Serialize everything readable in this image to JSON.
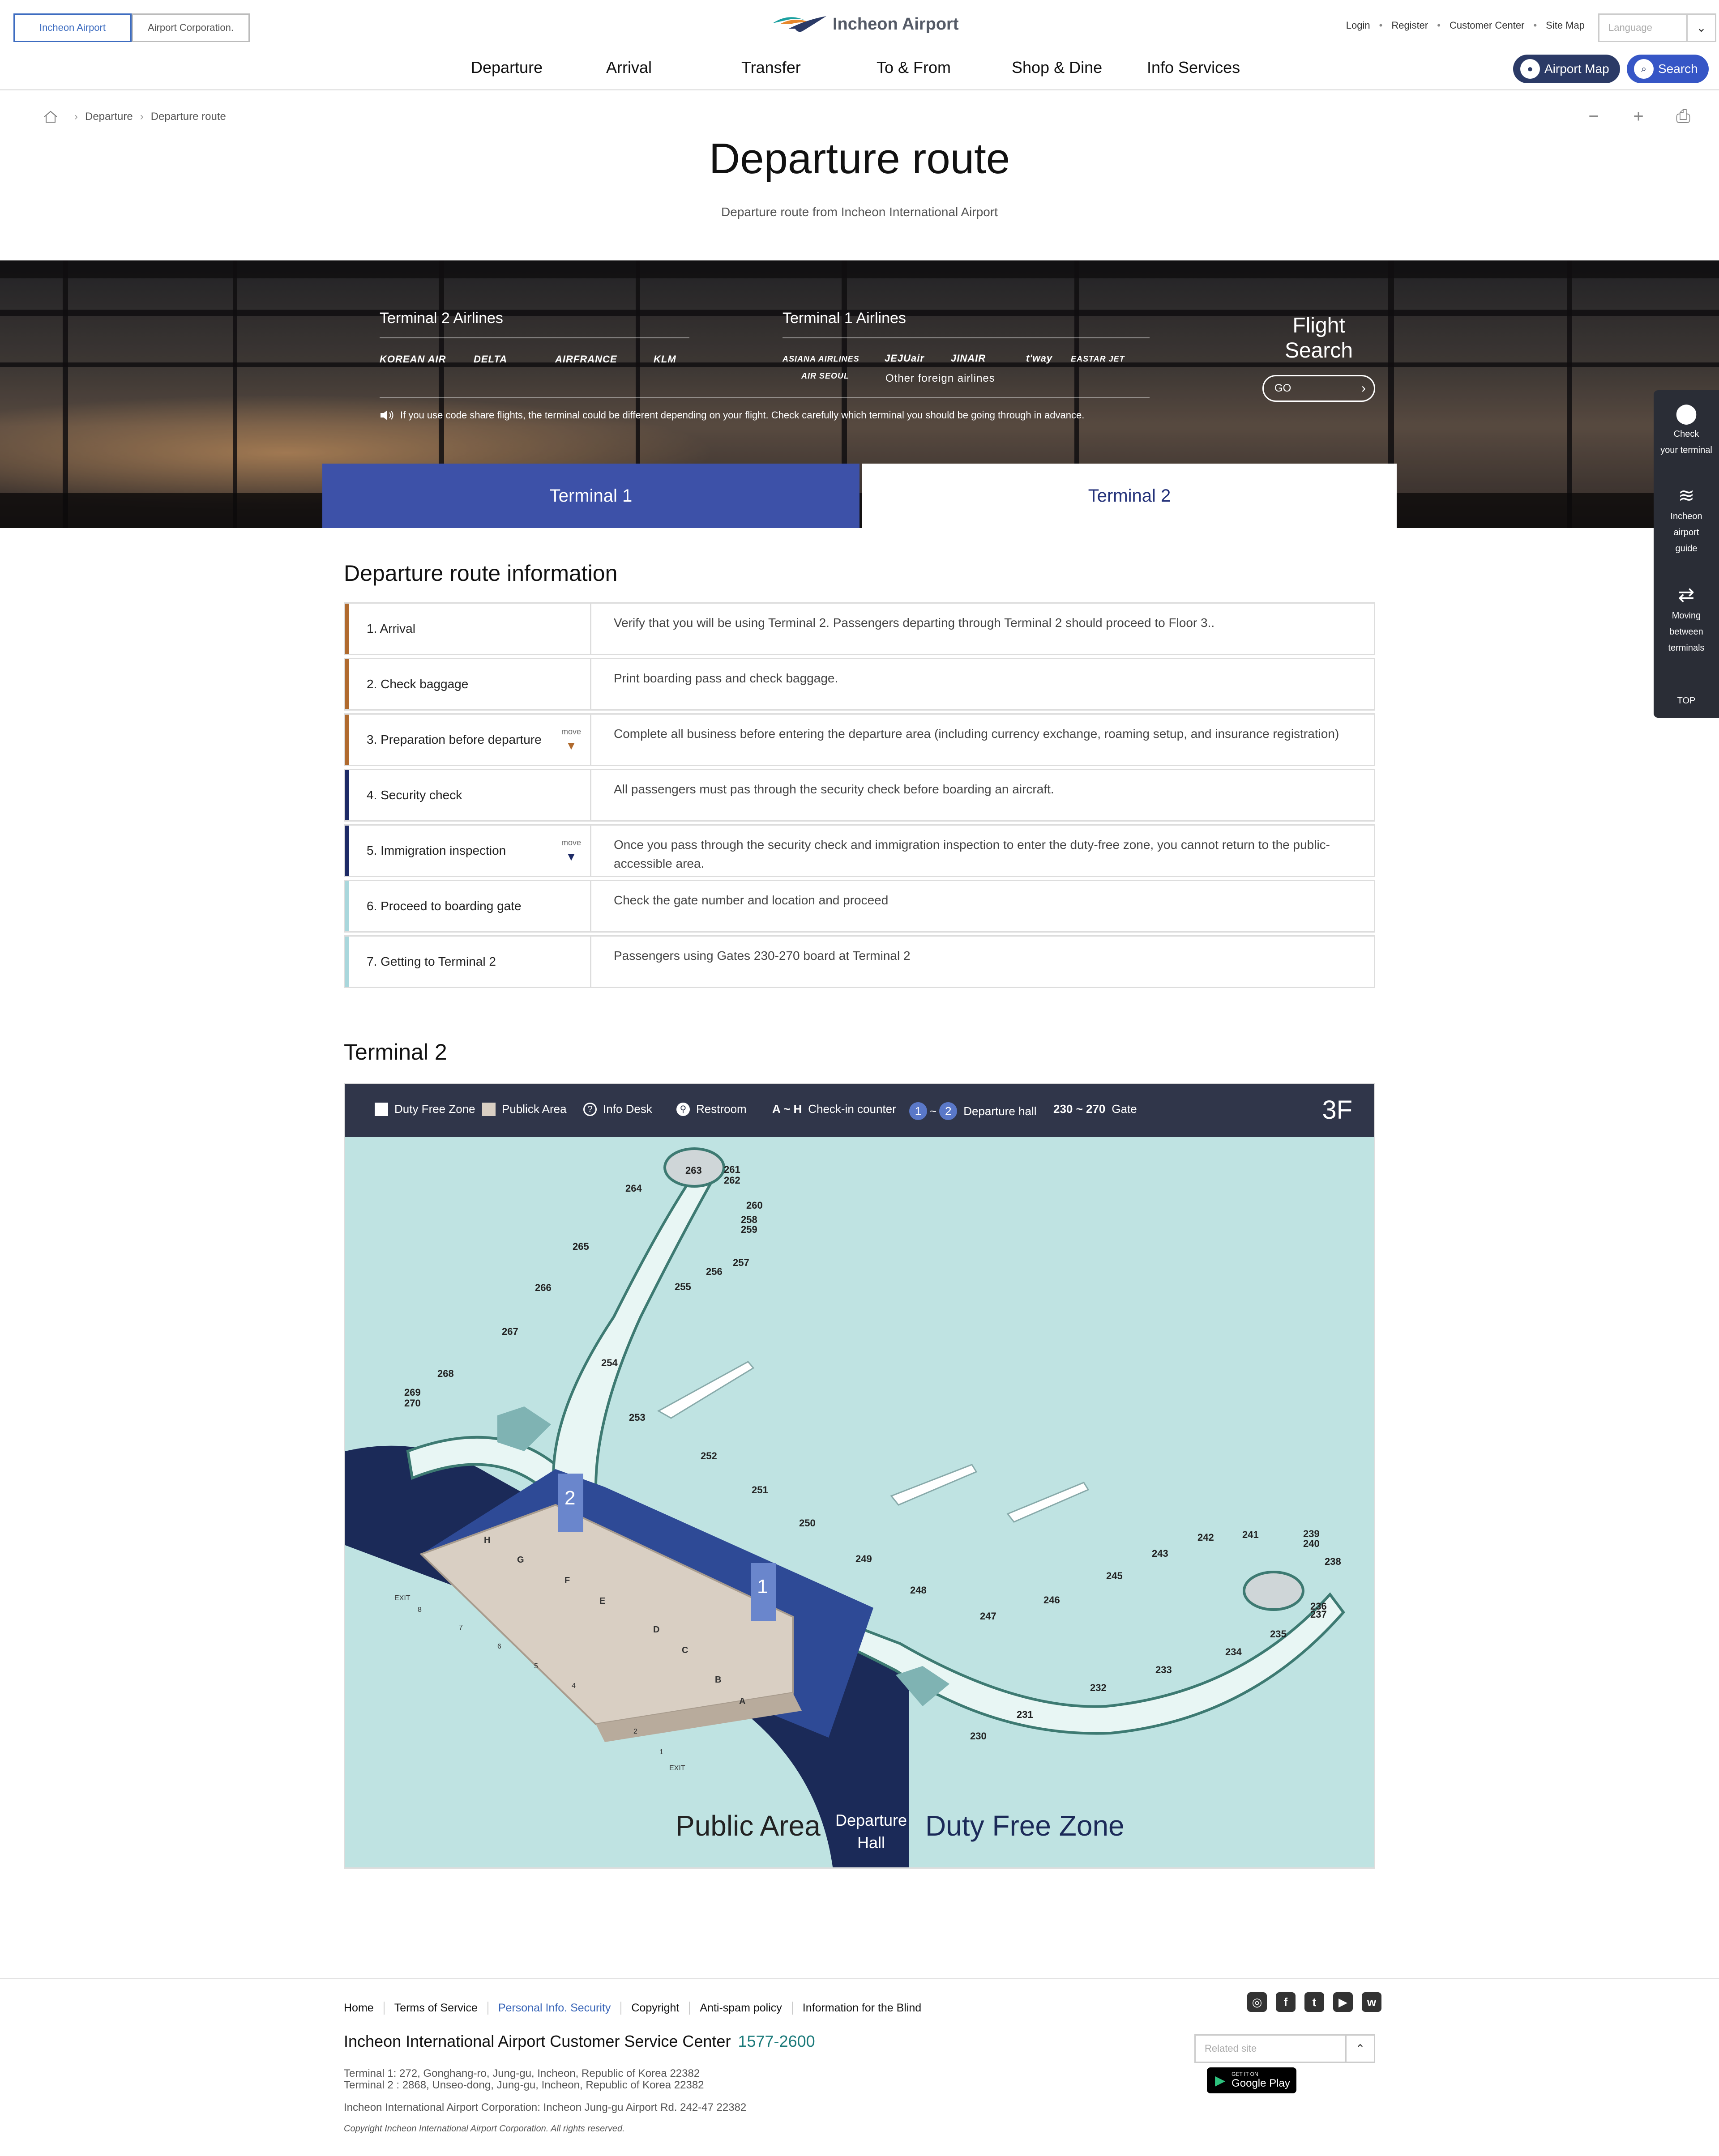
{
  "header": {
    "site_tabs": [
      "Incheon Airport",
      "Airport Corporation."
    ],
    "logo_text": "Incheon Airport",
    "util": [
      "Login",
      "Register",
      "Customer Center",
      "Site Map"
    ],
    "language_placeholder": "Language",
    "nav": [
      "Departure",
      "Arrival",
      "Transfer",
      "To & From",
      "Shop & Dine",
      "Info Services"
    ],
    "airport_map": "Airport Map",
    "search": "Search"
  },
  "breadcrumb": [
    "Departure",
    "Departure route"
  ],
  "page": {
    "title": "Departure route",
    "subtitle": "Departure route from Incheon International Airport"
  },
  "banner": {
    "t2_heading": "Terminal 2 Airlines",
    "t2_airlines": [
      "KOREAN AIR",
      "DELTA",
      "AIRFRANCE",
      "KLM"
    ],
    "t1_heading": "Terminal 1 Airlines",
    "t1_airlines": [
      "ASIANA AIRLINES",
      "JEJUair",
      "JINAIR",
      "t'way",
      "EASTAR JET",
      "AIR SEOUL"
    ],
    "t1_other": "Other foreign airlines",
    "notice": "If you use code share flights, the terminal could be different depending on your flight. Check carefully which terminal you should be going through in advance.",
    "flight_search_1": "Flight",
    "flight_search_2": "Search",
    "go": "GO",
    "tab1": "Terminal 1",
    "tab2": "Terminal 2"
  },
  "quick": {
    "item1": [
      "Check",
      "your terminal"
    ],
    "item2": [
      "Incheon",
      "airport",
      "guide"
    ],
    "item3": [
      "Moving",
      "between",
      "terminals"
    ],
    "top": "TOP"
  },
  "route": {
    "title": "Departure route information",
    "move_label": "move",
    "rows": [
      {
        "step": "1. Arrival",
        "desc": "Verify that you will be using Terminal 2. Passengers departing through Terminal 2 should proceed to Floor 3..",
        "color": "#b06a2e"
      },
      {
        "step": "2. Check baggage",
        "desc": "Print boarding pass and check baggage.",
        "color": "#b06a2e"
      },
      {
        "step": "3. Preparation before departure",
        "desc": "Complete all business before entering the departure area (including currency exchange, roaming setup, and insurance registration)",
        "color": "#b06a2e"
      },
      {
        "step": "4. Security check",
        "desc": "All passengers must pas through the security check before boarding an aircraft.",
        "color": "#1d2a66"
      },
      {
        "step": "5. Immigration inspection",
        "desc": "Once you pass through the security check and immigration inspection to enter the duty-free zone, you cannot return to the public-accessible area.",
        "color": "#1d2a66"
      },
      {
        "step": "6. Proceed to boarding gate",
        "desc": "Check the gate number and location and proceed",
        "color": "#a9d7dc"
      },
      {
        "step": "7. Getting to Terminal 2",
        "desc": "Passengers using Gates 230-270 board at Terminal 2",
        "color": "#a9d7dc"
      }
    ]
  },
  "map": {
    "title": "Terminal 2",
    "legend": {
      "duty_free": "Duty Free Zone",
      "public": "Publick Area",
      "info": "Info Desk",
      "restroom": "Restroom",
      "checkin_range": "A ~ H",
      "checkin": "Check-in counter",
      "hall_a": "1",
      "hall_tilde": "~",
      "hall_b": "2",
      "hall": "Departure hall",
      "gate_range": "230 ~ 270",
      "gate": "Gate"
    },
    "floor": "3F",
    "public_area": "Public Area",
    "departure_hall_1": "Departure",
    "departure_hall_2": "Hall",
    "duty_free_zone": "Duty Free Zone",
    "exit": "EXIT",
    "gates_top": [
      "263",
      "261",
      "262",
      "264",
      "260",
      "258",
      "259",
      "265",
      "257",
      "256",
      "266",
      "255",
      "267",
      "254",
      "268",
      "269",
      "270",
      "253",
      "252",
      "251",
      "250",
      "249",
      "248",
      "247",
      "246",
      "245",
      "243",
      "242",
      "241",
      "239",
      "240",
      "238",
      "236",
      "237",
      "235",
      "234",
      "233",
      "232",
      "231",
      "230"
    ],
    "counters": [
      "H",
      "G",
      "F",
      "E",
      "D",
      "C",
      "B",
      "A"
    ],
    "counter_rows": [
      "8",
      "7",
      "6",
      "5",
      "4",
      "2",
      "1"
    ],
    "hall_numbers": [
      "2",
      "1"
    ]
  },
  "footer": {
    "links": [
      "Home",
      "Terms of Service",
      "Personal Info. Security",
      "Copyright",
      "Anti-spam policy",
      "Information for the Blind"
    ],
    "cs": "Incheon International Airport Customer Service Center",
    "tel": "1577-2600",
    "addr1": "Terminal 1: 272, Gonghang-ro, Jung-gu, Incheon, Republic of Korea 22382",
    "addr2": "Terminal 2 : 2868, Unseo-dong, Jung-gu, Incheon, Republic of Korea 22382",
    "addr3": "Incheon International Airport Corporation: Incheon Jung-gu Airport Rd. 242-47 22382",
    "copyright": "Copyright Incheon International Airport Corporation. All rights reserved.",
    "related": "Related site",
    "gplay_small": "GET IT ON",
    "gplay": "Google Play",
    "sns": [
      "instagram-icon",
      "facebook-icon",
      "twitter-icon",
      "youtube-icon",
      "weibo-icon"
    ]
  }
}
